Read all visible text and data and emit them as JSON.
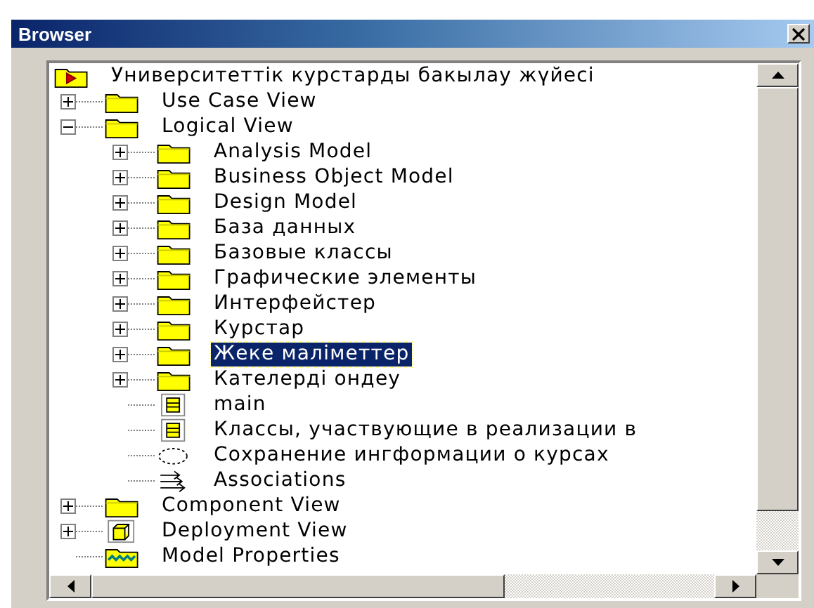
{
  "window": {
    "title": "Browser"
  },
  "tree": {
    "label": "Университеттік курстарды бакылау жүйесі",
    "kind": "model",
    "selected": false,
    "children": [
      {
        "label": "Use Case View",
        "kind": "folder",
        "expanded": false,
        "selected": false
      },
      {
        "label": "Logical View",
        "kind": "folder",
        "expanded": true,
        "selected": false,
        "children": [
          {
            "label": "Analysis Model",
            "kind": "folder",
            "expanded": false,
            "selected": false
          },
          {
            "label": "Business Object Model",
            "kind": "folder",
            "expanded": false,
            "selected": false
          },
          {
            "label": "Design Model",
            "kind": "folder",
            "expanded": false,
            "selected": false
          },
          {
            "label": "База данных",
            "kind": "folder",
            "expanded": false,
            "selected": false
          },
          {
            "label": "Базовые классы",
            "kind": "folder",
            "expanded": false,
            "selected": false
          },
          {
            "label": "Графические элементы",
            "kind": "folder",
            "expanded": false,
            "selected": false
          },
          {
            "label": "Интерфейстер",
            "kind": "folder",
            "expanded": false,
            "selected": false
          },
          {
            "label": "Курстар",
            "kind": "folder",
            "expanded": false,
            "selected": false
          },
          {
            "label": "Жеке маліметтер",
            "kind": "folder",
            "expanded": false,
            "selected": true
          },
          {
            "label": "Кателерді ондеу",
            "kind": "folder",
            "expanded": false,
            "selected": false
          },
          {
            "label": "main",
            "kind": "diagram",
            "selected": false
          },
          {
            "label": "Классы, участвующие в реализации в",
            "kind": "diagram",
            "selected": false
          },
          {
            "label": "Сохранение ингформации о курсах",
            "kind": "usecase",
            "selected": false
          },
          {
            "label": "Associations",
            "kind": "associations",
            "selected": false
          }
        ]
      },
      {
        "label": "Component View",
        "kind": "folder",
        "expanded": false,
        "selected": false
      },
      {
        "label": "Deployment View",
        "kind": "deployment",
        "expanded": false,
        "selected": false
      },
      {
        "label": "Model Properties",
        "kind": "properties",
        "selected": false
      }
    ]
  }
}
